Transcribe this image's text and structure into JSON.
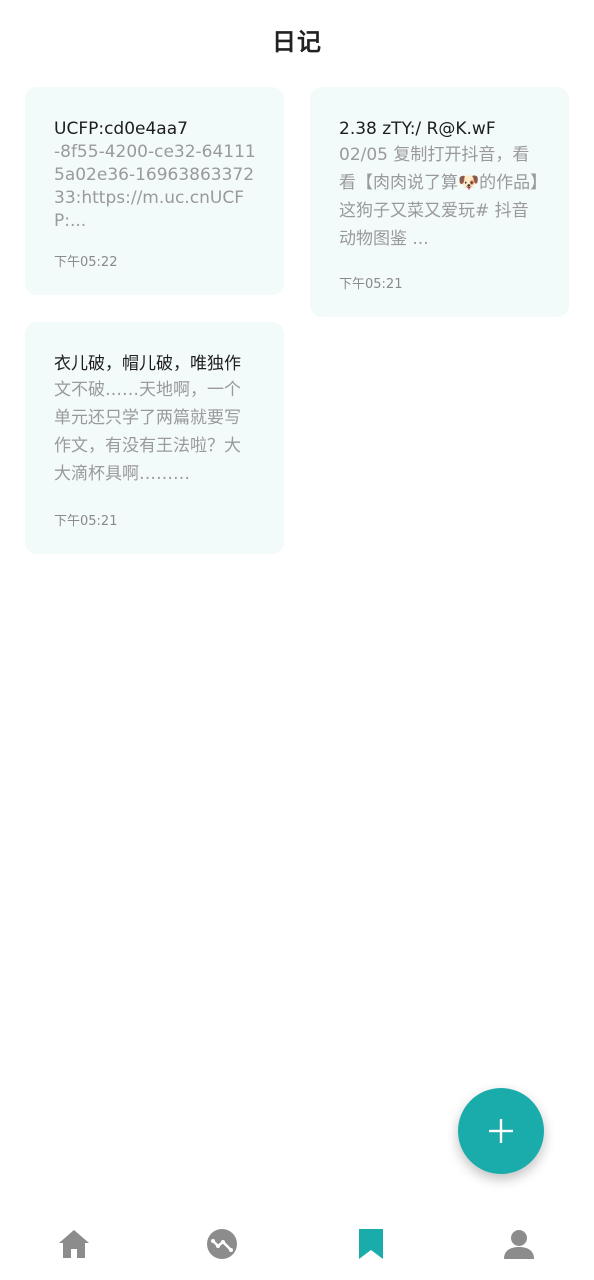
{
  "header": {
    "title": "日记"
  },
  "entries": [
    {
      "title": "UCFP:cd0e4aa7",
      "body": "-8f55-4200-ce32-641115a02e36-1696386337233:https://m.uc.cnUCFP:...",
      "time": "下午05:22"
    },
    {
      "title": "2.38 zTY:/ R@K.wF",
      "body": "02/05 复制打开抖音，看看【肉肉说了算🐶的作品】这狗子又菜又爱玩# 抖音动物图鉴 ...",
      "time": "下午05:21"
    },
    {
      "title": "衣儿破，帽儿破，唯独作",
      "body": "文不破……天地啊，一个单元还只学了两篇就要写作文，有没有王法啦？大大滴杯具啊………",
      "time": "下午05:21"
    }
  ],
  "fab": {
    "icon": "plus-icon",
    "color": "#1aabab"
  },
  "bottom_nav": {
    "items": [
      {
        "icon": "home-icon",
        "active": false
      },
      {
        "icon": "trend-chart-icon",
        "active": false
      },
      {
        "icon": "bookmark-icon",
        "active": true
      },
      {
        "icon": "user-icon",
        "active": false
      }
    ],
    "active_color": "#1aabab",
    "inactive_color": "#8c8c8c"
  }
}
